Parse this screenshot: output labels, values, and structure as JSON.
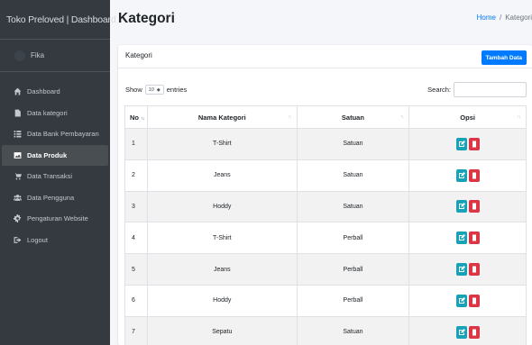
{
  "brand": {
    "title": "Toko Preloved | Dashboard"
  },
  "user": {
    "name": "Fika"
  },
  "sidebar": {
    "items": [
      {
        "label": "Dashboard",
        "icon": "home-icon",
        "active": false
      },
      {
        "label": "Data kategori",
        "icon": "file-icon",
        "active": false
      },
      {
        "label": "Data Bank Pembayaran",
        "icon": "list-icon",
        "active": false
      },
      {
        "label": "Data Produk",
        "icon": "image-icon",
        "active": true
      },
      {
        "label": "Data Transaksi",
        "icon": "cart-icon",
        "active": false
      },
      {
        "label": "Data Pengguna",
        "icon": "users-icon",
        "active": false
      },
      {
        "label": "Pengaturan Website",
        "icon": "cog-icon",
        "active": false
      },
      {
        "label": "Logout",
        "icon": "sign-out-icon",
        "active": false
      }
    ]
  },
  "header": {
    "title": "Kategori",
    "breadcrumb": {
      "home": "Home",
      "separator": "/",
      "current": "Kategori"
    }
  },
  "card": {
    "title": "Kategori",
    "add_button": "Tambah Data"
  },
  "table_controls": {
    "show_label": "Show",
    "entries_value": "10",
    "entries_label": "entries",
    "search_label": "Search:"
  },
  "table": {
    "columns": [
      "No",
      "Nama Kategori",
      "Satuan",
      "Opsi"
    ],
    "rows": [
      {
        "no": "1",
        "nama": "T-Shirt",
        "satuan": "Satuan"
      },
      {
        "no": "2",
        "nama": "Jeans",
        "satuan": "Satuan"
      },
      {
        "no": "3",
        "nama": "Hoddy",
        "satuan": "Satuan"
      },
      {
        "no": "4",
        "nama": "T-Shirt",
        "satuan": "Perball"
      },
      {
        "no": "5",
        "nama": "Jeans",
        "satuan": "Perball"
      },
      {
        "no": "6",
        "nama": "Hoddy",
        "satuan": "Perball"
      },
      {
        "no": "7",
        "nama": "Sepatu",
        "satuan": "Satuan"
      }
    ]
  },
  "colors": {
    "sidebar_bg": "#343a40",
    "primary": "#007bff",
    "edit": "#17a2b8",
    "delete": "#dc3545"
  }
}
